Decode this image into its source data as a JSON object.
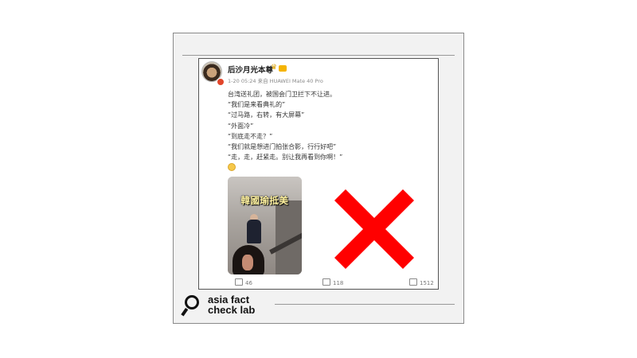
{
  "post": {
    "username": "后沙月光本尊",
    "meta": "1-20 05:24 来自 HUAWEI Mate 40 Pro",
    "lines": [
      "台湾送礼团，被国会门卫拦下不让进。",
      "“我们是来看典礼的”",
      "“过马路，右转，有大屏幕”",
      "“外面冷”",
      "“到底走不走？”",
      "“我们就是想进门拍张合影，行行好吧”",
      "“走，走，赶紧走。别让我再看到你啊！”"
    ],
    "video_caption": "韓國瑜抵美",
    "reposts": "46",
    "comments": "118",
    "likes": "1512"
  },
  "logo": {
    "line1": "asia fact",
    "line2": "check lab"
  },
  "colors": {
    "x_mark": "#ff0000",
    "frame_bg": "#f2f2f2"
  }
}
